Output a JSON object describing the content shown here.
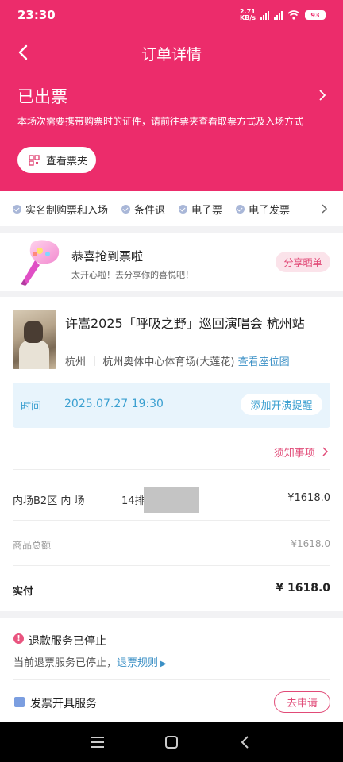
{
  "status_bar": {
    "time": "23:30",
    "net_speed_value": "2.71",
    "net_speed_unit": "KB/s",
    "battery": "93"
  },
  "header": {
    "title": "订单详情",
    "ticket_status": "已出票",
    "note": "本场次需要携带购票时的证件，请前往票夹查看取票方式及入场方式",
    "wallet_button": "查看票夹",
    "color": "#ec2c6b"
  },
  "tags": [
    "实名制购票和入场",
    "条件退",
    "电子票",
    "电子发票"
  ],
  "congrats": {
    "title": "恭喜抢到票啦",
    "subtitle": "太开心啦！去分享你的喜悦吧！",
    "share_button": "分享晒单"
  },
  "show": {
    "title": "许嵩2025「呼吸之野」巡回演唱会 杭州站",
    "city": "杭州",
    "separator": "丨",
    "venue": "杭州奥体中心体育场(大莲花)",
    "map_link": "查看座位图",
    "time_label": "时间",
    "time_value": "2025.07.27 19:30",
    "remind_button": "添加开演提醒",
    "notice_link": "须知事项"
  },
  "order": {
    "seat_area": "内场B2区 内  场",
    "seat_row": "14排",
    "seat_price": "¥1618.0",
    "total_label": "商品总额",
    "total_value": "¥1618.0",
    "paid_label": "实付",
    "paid_value": "¥ 1618.0"
  },
  "service": {
    "refund_title": "退款服务已停止",
    "refund_note": "当前退票服务已停止，",
    "refund_rule": "退票规则",
    "invoice_title": "发票开具服务",
    "apply_button": "去申请"
  }
}
